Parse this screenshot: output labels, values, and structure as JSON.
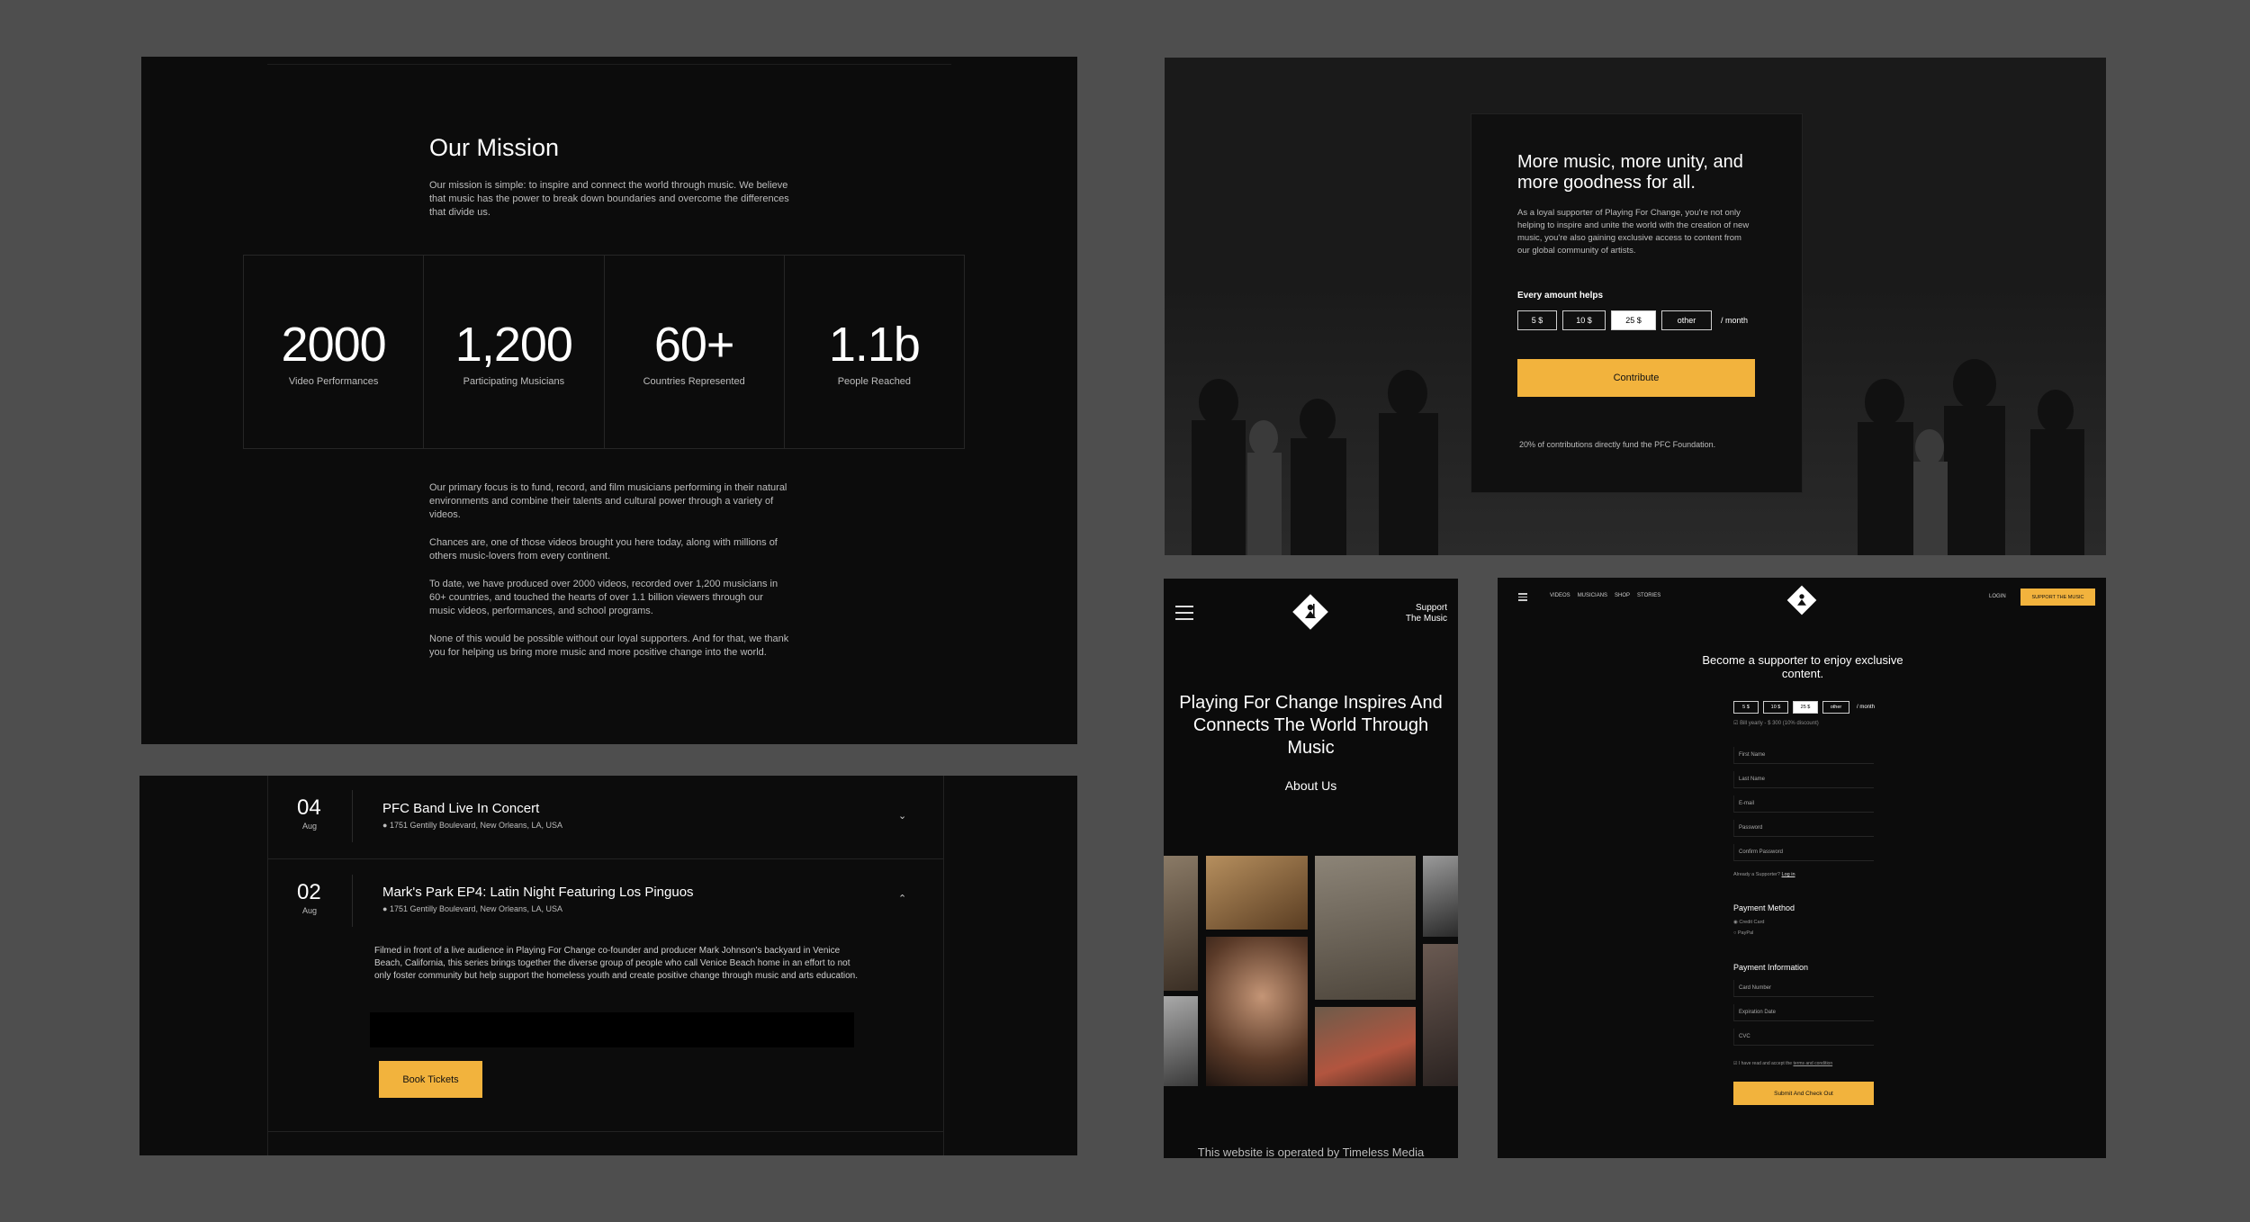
{
  "mission": {
    "title": "Our Mission",
    "intro": "Our mission is simple: to inspire and connect the world through music. We believe that music has the power to break down boundaries and overcome the differences that divide us.",
    "stats": [
      {
        "value": "2000",
        "label": "Video Performances"
      },
      {
        "value": "1,200",
        "label": "Participating Musicians"
      },
      {
        "value": "60+",
        "label": "Countries Represented"
      },
      {
        "value": "1.1b",
        "label": "People Reached"
      }
    ],
    "paragraphs": [
      "Our primary focus is to fund, record, and film musicians performing in their natural environments and combine their talents and cultural power through a variety of videos.",
      "Chances are, one of those videos brought you here today, along with millions of others music-lovers from every continent.",
      "To date, we have produced over 2000 videos, recorded over 1,200 musicians in 60+ countries, and touched the hearts of over 1.1 billion viewers through our music videos, performances, and school programs.",
      "None of this would be possible without our loyal supporters. And for that, we thank you for helping us bring more music and more positive change into the world."
    ]
  },
  "contribute": {
    "headline": "More music, more unity, and more goodness for all.",
    "description": "As a loyal supporter of Playing For Change, you're not only helping to inspire and unite the world with the creation of new music, you're also gaining exclusive access to content from our global community of artists.",
    "helps_label": "Every amount helps",
    "amounts": [
      "5 $",
      "10 $",
      "25 $",
      "other"
    ],
    "selected_amount": "25 $",
    "per_month": "/ month",
    "button": "Contribute",
    "footnote": "20% of contributions directly fund the PFC Foundation."
  },
  "events": {
    "items": [
      {
        "day": "04",
        "month": "Aug",
        "name": "PFC Band Live In Concert",
        "location": "1751 Gentilly Boulevard, New Orleans, LA, USA",
        "chevron": "⌄"
      },
      {
        "day": "02",
        "month": "Aug",
        "name": "Mark's Park EP4: Latin Night Featuring Los Pinguos",
        "location": "1751 Gentilly Boulevard, New Orleans, LA, USA",
        "chevron": "⌃"
      }
    ],
    "description": "Filmed in front of a live audience in Playing For Change co-founder and producer Mark Johnson's backyard in Venice Beach, California, this series brings together the diverse group of people who call Venice Beach home in an effort to not only foster community but help support the homeless youth and create positive change through music and arts education.",
    "book_button": "Book Tickets"
  },
  "mobile": {
    "support_line1": "Support",
    "support_line2": "The Music",
    "hero": "Playing For Change Inspires And Connects The World Through Music",
    "about": "About Us",
    "operated": "This website is operated by Timeless Media"
  },
  "signup": {
    "nav": [
      "VIDEOS",
      "MUSICIANS",
      "SHOP",
      "STORIES"
    ],
    "login": "LOGIN",
    "support_button": "SUPPORT THE MUSIC",
    "headline": "Become a supporter to enjoy exclusive content.",
    "amounts": [
      "5 $",
      "10 $",
      "25 $",
      "other"
    ],
    "per_month": "/ month",
    "yearly": "Bill yearly - $ 300 (10% discount)",
    "fields": [
      "First Name",
      "Last Name",
      "E-mail",
      "Password",
      "Confirm Password"
    ],
    "already": "Already a Supporter?",
    "login_link": "Log in",
    "payment_method": "Payment Method",
    "methods": [
      "Credit Card",
      "PayPal"
    ],
    "payment_info": "Payment Information",
    "card_fields": [
      "Card Number",
      "Expiration Date",
      "CVC"
    ],
    "agree": "I have read and accept the",
    "terms": "terms and condition",
    "submit": "Submit And Check Out"
  },
  "colors": {
    "accent": "#f2b33d",
    "background": "#0c0c0c",
    "canvas": "#4e4e4e"
  }
}
